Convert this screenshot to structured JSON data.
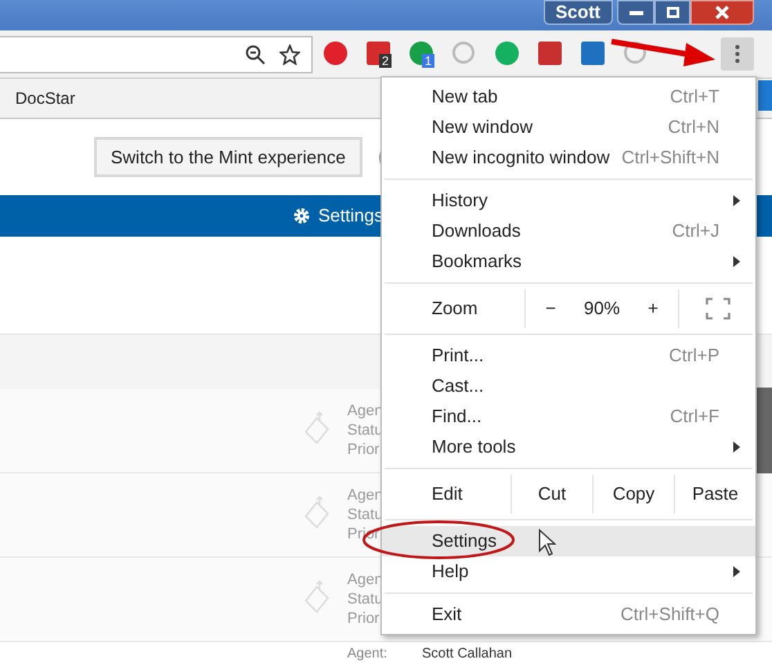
{
  "titlebar": {
    "profile": "Scott"
  },
  "extensions": [
    {
      "kind": "stop"
    },
    {
      "kind": "dots",
      "badge": "2"
    },
    {
      "kind": "chat",
      "badge": "1"
    },
    {
      "kind": "ring"
    },
    {
      "kind": "round"
    },
    {
      "kind": "book"
    },
    {
      "kind": "square"
    },
    {
      "kind": "ring"
    }
  ],
  "bookmarks": [
    "DocStar"
  ],
  "page": {
    "switch_button": "Switch to the Mint experience",
    "nav_link": "Settings",
    "rows": [
      {
        "lines": [
          "Agen",
          "Statu",
          "Prior"
        ]
      },
      {
        "lines": [
          "Agen",
          "Statu",
          "Prior"
        ]
      },
      {
        "lines": [
          "Agen",
          "Statu",
          "Prior"
        ]
      }
    ],
    "last_row": {
      "label": "Agent:",
      "value": "Scott Callahan"
    }
  },
  "menu": {
    "groups": [
      [
        {
          "kind": "item",
          "label": "New tab",
          "shortcut": "Ctrl+T",
          "submenu": false,
          "selected": false
        },
        {
          "kind": "item",
          "label": "New window",
          "shortcut": "Ctrl+N",
          "submenu": false,
          "selected": false
        },
        {
          "kind": "item",
          "label": "New incognito window",
          "shortcut": "Ctrl+Shift+N",
          "submenu": false,
          "selected": false
        }
      ],
      [
        {
          "kind": "item",
          "label": "History",
          "submenu": true,
          "selected": false
        },
        {
          "kind": "item",
          "label": "Downloads",
          "shortcut": "Ctrl+J",
          "submenu": false,
          "selected": false
        },
        {
          "kind": "item",
          "label": "Bookmarks",
          "submenu": true,
          "selected": false
        }
      ],
      [
        {
          "kind": "zoom",
          "label": "Zoom",
          "minus": "−",
          "value": "90%",
          "plus": "+"
        }
      ],
      [
        {
          "kind": "item",
          "label": "Print...",
          "shortcut": "Ctrl+P",
          "submenu": false,
          "selected": false
        },
        {
          "kind": "item",
          "label": "Cast...",
          "submenu": false,
          "selected": false
        },
        {
          "kind": "item",
          "label": "Find...",
          "shortcut": "Ctrl+F",
          "submenu": false,
          "selected": false
        },
        {
          "kind": "item",
          "label": "More tools",
          "submenu": true,
          "selected": false
        }
      ],
      [
        {
          "kind": "edit",
          "label": "Edit",
          "buttons": [
            "Cut",
            "Copy",
            "Paste"
          ]
        }
      ],
      [
        {
          "kind": "item",
          "label": "Settings",
          "submenu": false,
          "selected": true
        },
        {
          "kind": "item",
          "label": "Help",
          "submenu": true,
          "selected": false
        }
      ],
      [
        {
          "kind": "item",
          "label": "Exit",
          "shortcut": "Ctrl+Shift+Q",
          "submenu": false,
          "selected": false
        }
      ]
    ]
  }
}
